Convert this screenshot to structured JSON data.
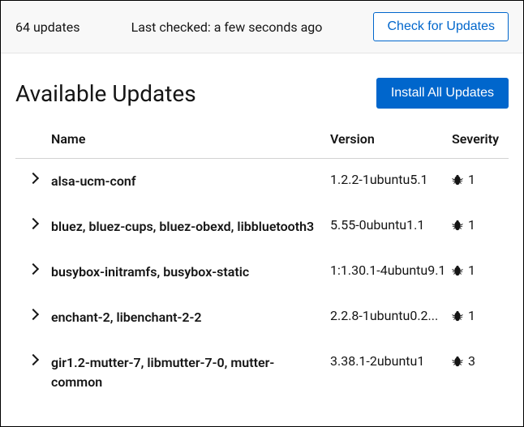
{
  "header": {
    "count_text": "64 updates",
    "last_checked": "Last checked: a few seconds ago",
    "check_button": "Check for Updates"
  },
  "title": "Available Updates",
  "install_button": "Install All Updates",
  "columns": {
    "name": "Name",
    "version": "Version",
    "severity": "Severity"
  },
  "rows": [
    {
      "name": "alsa-ucm-conf",
      "version": "1.2.2-1ubuntu5.1",
      "severity": "1"
    },
    {
      "name": "bluez, bluez-cups, bluez-obexd, libbluetooth3",
      "version": "5.55-0ubuntu1.1",
      "severity": "1"
    },
    {
      "name": "busybox-initramfs, busybox-static",
      "version": "1:1.30.1-4ubuntu9.1",
      "severity": "1"
    },
    {
      "name": "enchant-2, libenchant-2-2",
      "version": "2.2.8-1ubuntu0.2...",
      "severity": "1"
    },
    {
      "name": "gir1.2-mutter-7, libmutter-7-0, mutter-common",
      "version": "3.38.1-2ubuntu1",
      "severity": "3"
    }
  ]
}
